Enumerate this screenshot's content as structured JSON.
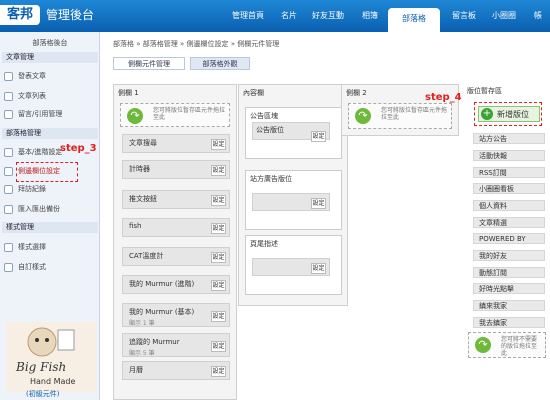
{
  "header": {
    "logo": "客邦",
    "site_title": "管理後台",
    "nav": [
      "管理首頁",
      "名片",
      "好友互動",
      "相簿",
      "部落格",
      "留言板",
      "小圈圈",
      "帳"
    ],
    "active_nav": "部落格"
  },
  "sidebar": {
    "heading": "部落格後台",
    "sections": [
      {
        "title": "文章管理",
        "items": [
          "發表文章",
          "文章列表",
          "留言/引用管理"
        ]
      },
      {
        "title": "部落格管理",
        "items": [
          "基本/進階設定",
          "側邊欄位設定",
          "拜訪紀錄",
          "匯入匯出備份"
        ]
      },
      {
        "title": "樣式管理",
        "items": [
          "樣式選擇",
          "自訂樣式"
        ]
      }
    ],
    "mascot": {
      "line1": "Big Fish",
      "line2": "Hand Made",
      "line3": "(初級元件)"
    }
  },
  "breadcrumb": "部落格 » 部落格管理 » 側邊欄位設定 » 側欄元件管理",
  "tabs": [
    "側欄元件管理",
    "部落格外觀"
  ],
  "annotations": {
    "step3": "step_3",
    "step4": "step_4"
  },
  "col1": {
    "title": "側欄 1",
    "hint": "您可將版位暫存區元件拖拉至此",
    "widgets": [
      {
        "name": "文章搜尋",
        "sub": ""
      },
      {
        "name": "計時器",
        "sub": ""
      },
      {
        "name": "推文按鈕",
        "sub": ""
      },
      {
        "name": "fish",
        "sub": ""
      },
      {
        "name": "CAT溫度計",
        "sub": ""
      },
      {
        "name": "我的 Murmur (進階)",
        "sub": ""
      },
      {
        "name": "我的 Murmur (基本)",
        "sub": "顯示 1 筆"
      },
      {
        "name": "追蹤的 Murmur",
        "sub": "顯示 5 筆"
      },
      {
        "name": "月曆",
        "sub": ""
      }
    ],
    "set_label": "設定"
  },
  "content_col": {
    "title": "內容欄",
    "boxes": [
      {
        "title": "公告區塊",
        "inner": "公告版位"
      },
      {
        "title": "站方廣告版位",
        "inner": ""
      },
      {
        "title": "頁尾指述",
        "inner": ""
      }
    ]
  },
  "col2": {
    "title": "側欄 2",
    "hint": "您可將版位暫存區元件拖拉至此"
  },
  "stash": {
    "title": "版位暫存區",
    "add_button": "新增版位",
    "items": [
      "站方公告",
      "活動快報",
      "RSS訂閱",
      "小圈圈看板",
      "個人資料",
      "文章精選",
      "POWERED BY",
      "我的好友",
      "動態訂閱",
      "好時光點擊",
      "鎮來我家",
      "我去鎮家"
    ],
    "hint": "您可將不需要的版位拖拉至此"
  },
  "colors": {
    "header_blue": "#0a5fb0",
    "annotation_red": "#e02020",
    "add_green": "#3aa335"
  }
}
